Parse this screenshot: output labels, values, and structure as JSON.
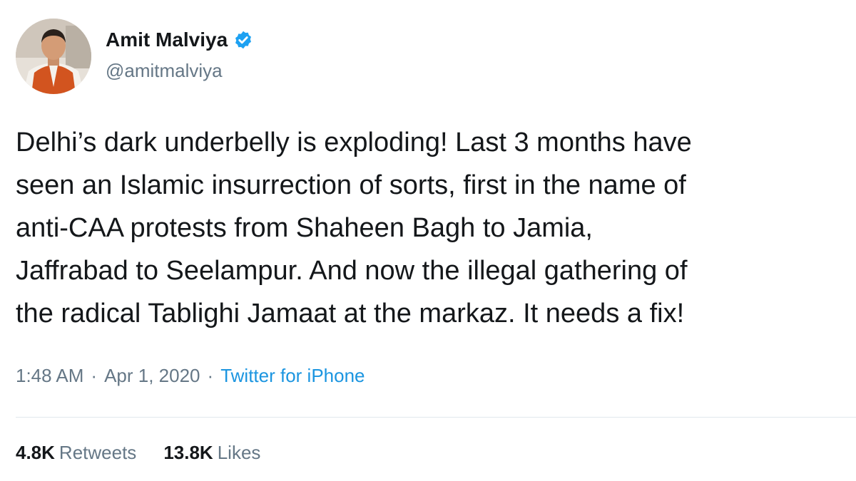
{
  "user": {
    "display_name": "Amit Malviya",
    "handle": "@amitmalviya",
    "verified": true
  },
  "tweet": {
    "lines": [
      "Delhi’s dark underbelly is exploding! Last 3 months have",
      "seen an Islamic insurrection of sorts, first in the name of",
      "anti-CAA protests from Shaheen Bagh to Jamia,",
      "Jaffrabad to Seelampur. And now the illegal gathering of",
      "the radical Tablighi Jamaat at the markaz. It needs a fix!"
    ],
    "time": "1:48 AM",
    "separator": "·",
    "date": "Apr 1, 2020",
    "source": "Twitter for iPhone"
  },
  "stats": {
    "retweets_count": "4.8K",
    "retweets_label": "Retweets",
    "likes_count": "13.8K",
    "likes_label": "Likes"
  },
  "colors": {
    "text": "#14171a",
    "secondary": "#657786",
    "link": "#1b95e0",
    "verified": "#1da1f2",
    "divider": "#e1e8ed"
  },
  "icons": {
    "verified": "verified-badge-icon",
    "avatar": "profile-photo"
  }
}
